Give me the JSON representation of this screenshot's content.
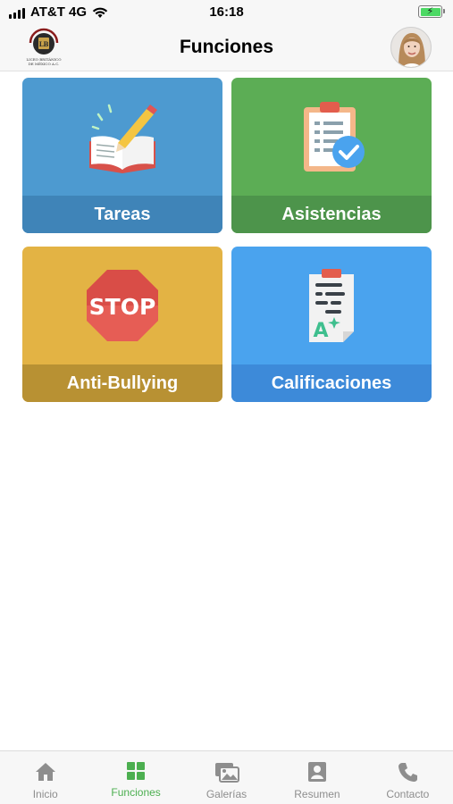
{
  "status_bar": {
    "carrier": "AT&T 4G",
    "time": "16:18"
  },
  "nav": {
    "title": "Funciones",
    "logo_text_line1": "LICEO BRITÁNICO",
    "logo_text_line2": "DE MÉXICO A.C."
  },
  "cards": [
    {
      "label": "Tareas",
      "color": "#4d9ad0",
      "label_color": "#3f84b8",
      "icon": "book-pencil-icon"
    },
    {
      "label": "Asistencias",
      "color": "#5cad55",
      "label_color": "#4d944b",
      "icon": "clipboard-check-icon"
    },
    {
      "label": "Anti-Bullying",
      "color": "#e3b344",
      "label_color": "#b89133",
      "icon": "stop-sign-icon",
      "icon_text": "STOP"
    },
    {
      "label": "Calificaciones",
      "color": "#4aa3ee",
      "label_color": "#3d8ad9",
      "icon": "grade-report-icon",
      "icon_text": "A"
    }
  ],
  "tabs": [
    {
      "label": "Inicio",
      "icon": "home-icon",
      "active": false
    },
    {
      "label": "Funciones",
      "icon": "grid-icon",
      "active": true
    },
    {
      "label": "Galerías",
      "icon": "gallery-icon",
      "active": false
    },
    {
      "label": "Resumen",
      "icon": "profile-card-icon",
      "active": false
    },
    {
      "label": "Contacto",
      "icon": "phone-icon",
      "active": false
    }
  ],
  "colors": {
    "accent_active": "#4caf50",
    "inactive": "#8e8e8e",
    "bar_background": "#f7f7f7"
  }
}
